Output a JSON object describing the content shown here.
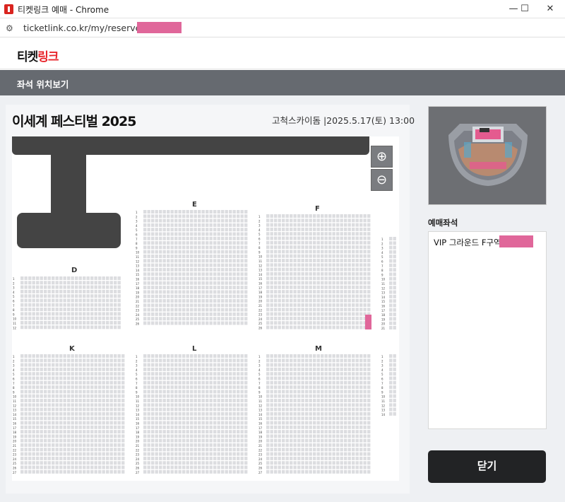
{
  "window": {
    "title": "티켓링크 예매 - Chrome",
    "minimize": "—",
    "maximize": "☐",
    "close": "✕"
  },
  "address": {
    "url": "ticketlink.co.kr/my/reserve/seat/"
  },
  "header": {
    "logo_black": "티켓",
    "logo_red": "링크"
  },
  "subnav": {
    "title": "좌석 위치보기"
  },
  "event": {
    "title": "이세계 페스티벌 2025",
    "info": "고척스카이돔 |2025.5.17(토) 13:00"
  },
  "map": {
    "sections_top": [
      "E",
      "F"
    ],
    "section_left": "D",
    "sections_bottom": [
      "K",
      "L",
      "M"
    ],
    "zoom_in": "⊕",
    "zoom_out": "⊖"
  },
  "reservation": {
    "label": "예매좌석",
    "seat": "VIP 그라운드 F구역 2"
  },
  "close_button": "닫기",
  "colors": {
    "accent_red": "#e8252b",
    "highlight_seat": "#e0679a",
    "stage": "#444444"
  }
}
